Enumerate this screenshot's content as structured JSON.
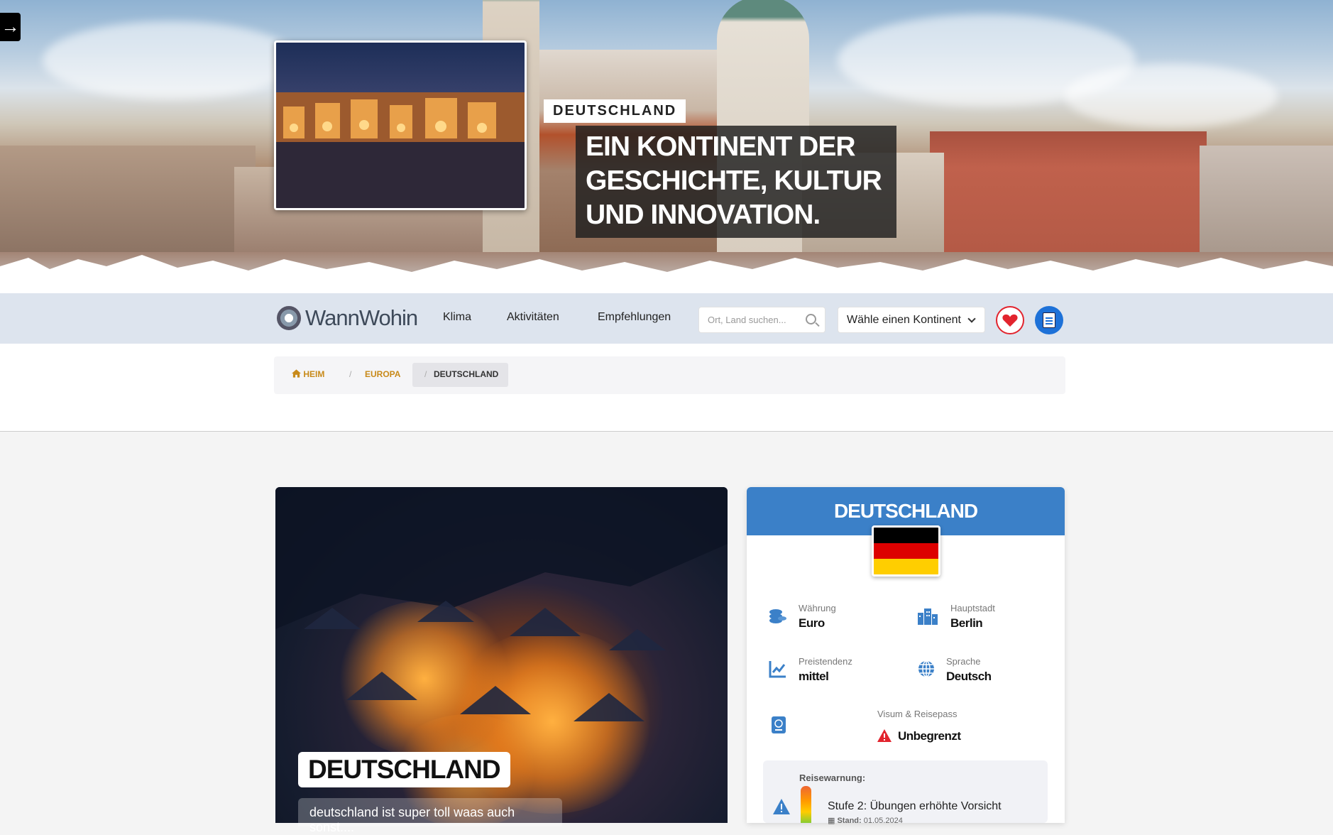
{
  "hero": {
    "country_tag": "DEUTSCHLAND",
    "headline": "EIN KONTINENT DER GESCHICHTE, KULTUR UND INNOVATION."
  },
  "sidebar_toggle": {
    "icon": "arrow-right-icon",
    "glyph": "→"
  },
  "nav": {
    "logo_text": "WannWohin",
    "links": [
      "Klima",
      "Aktivitäten",
      "Empfehlungen"
    ],
    "search_placeholder": "Ort, Land suchen...",
    "continent_select": "Wähle einen Kontinent"
  },
  "breadcrumb": {
    "home": "HEIM",
    "continent": "EUROPA",
    "country": "DEUTSCHLAND",
    "separator": "/"
  },
  "feature": {
    "title": "DEUTSCHLAND",
    "description": "deutschland ist super toll waas auch sonst...."
  },
  "info": {
    "title": "DEUTSCHLAND",
    "flag_colors": [
      "#000000",
      "#dd0000",
      "#ffce00"
    ],
    "currency_label": "Währung",
    "currency_value": "Euro",
    "capital_label": "Hauptstadt",
    "capital_value": "Berlin",
    "price_label": "Preistendenz",
    "price_value": "mittel",
    "language_label": "Sprache",
    "language_value": "Deutsch",
    "visa_label": "Visum & Reisepass",
    "visa_value": "Unbegrenzt",
    "warning_title": "Reisewarnung:",
    "warning_level": "Stufe 2: Übungen erhöhte Vorsicht",
    "warning_date_label": "Stand:",
    "warning_date": "01.05.2024"
  },
  "colors": {
    "accent": "#3b80c8",
    "breadcrumb_link": "#c88a1a",
    "favorite": "#e2242e",
    "planner": "#1d71d8"
  }
}
